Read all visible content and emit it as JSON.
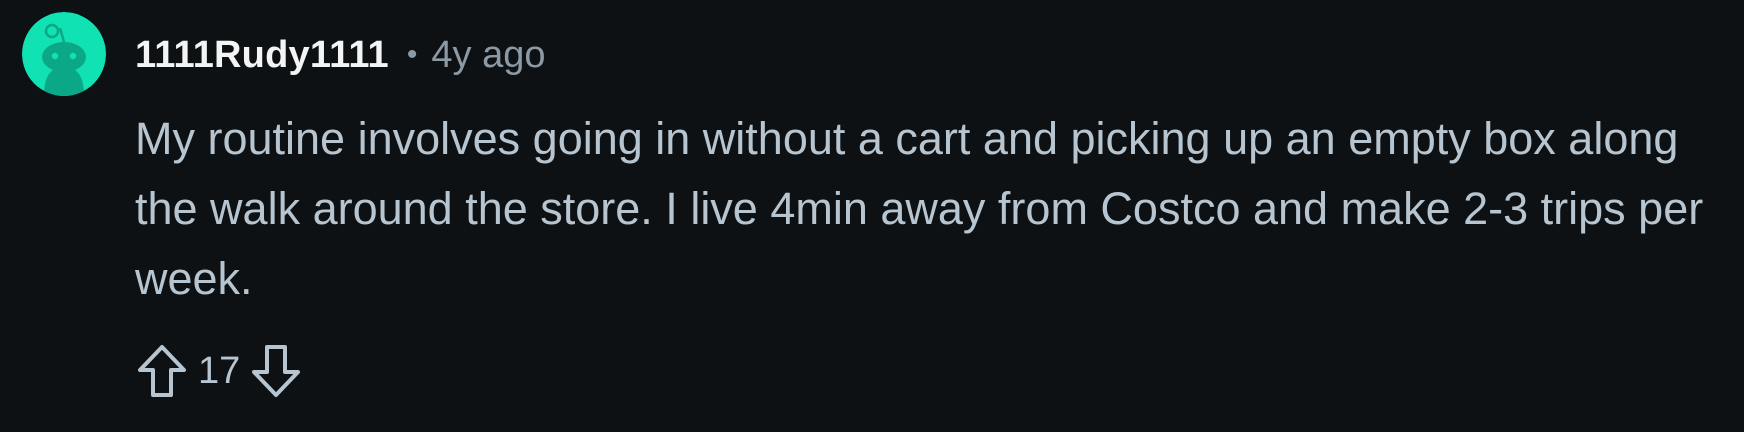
{
  "comment": {
    "author": "1111Rudy1111",
    "separator": "•",
    "age": "4y ago",
    "body": "My routine involves going in without a cart and picking up an empty box along the walk around the store. I live 4min away from Costco and make 2-3 trips per week.",
    "score": "17"
  },
  "icons": {
    "avatar": "snoo-avatar-icon",
    "upvote": "upvote-arrow-icon",
    "downvote": "downvote-arrow-icon"
  },
  "colors": {
    "background": "#0e1113",
    "avatar_bg": "#11e2b3",
    "username": "#f2f4f5",
    "muted": "#8c9aa5",
    "text": "#b7c5d0"
  }
}
